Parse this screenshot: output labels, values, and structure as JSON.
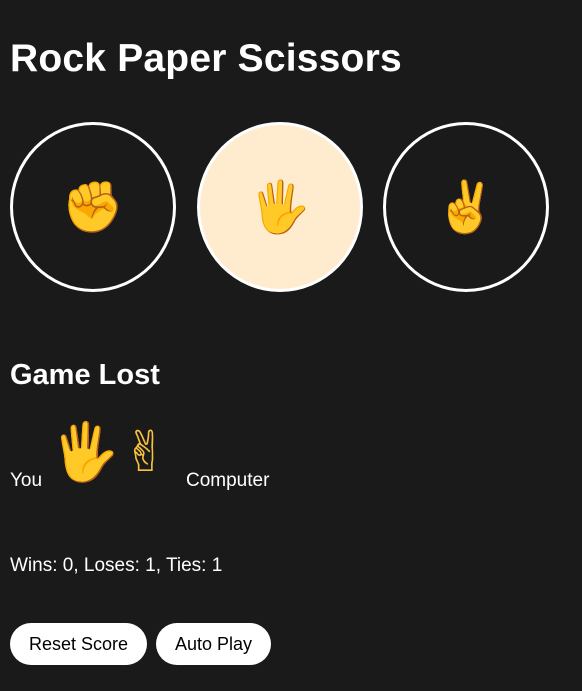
{
  "title": "Rock Paper Scissors",
  "moves": [
    {
      "name": "rock",
      "icon": "✊",
      "icon_name": "raised-fist-icon",
      "selected": false
    },
    {
      "name": "paper",
      "icon": "🖐",
      "icon_name": "raised-hand-icon",
      "selected": true
    },
    {
      "name": "scissors",
      "icon": "✌",
      "icon_name": "victory-hand-icon",
      "selected": false
    }
  ],
  "result": {
    "text": "Game Lost",
    "you_label": "You",
    "you_move_icon": "🖐",
    "computer_move_icon": "✌",
    "computer_label": "Computer"
  },
  "score": {
    "text": "Wins: 0, Loses: 1, Ties: 1",
    "wins": 0,
    "loses": 1,
    "ties": 1
  },
  "buttons": {
    "reset_label": "Reset Score",
    "auto_play_label": "Auto Play"
  },
  "colors": {
    "background": "#1a1a1a",
    "selected_move": "#ffeccf",
    "icon": "#f7c13c"
  }
}
